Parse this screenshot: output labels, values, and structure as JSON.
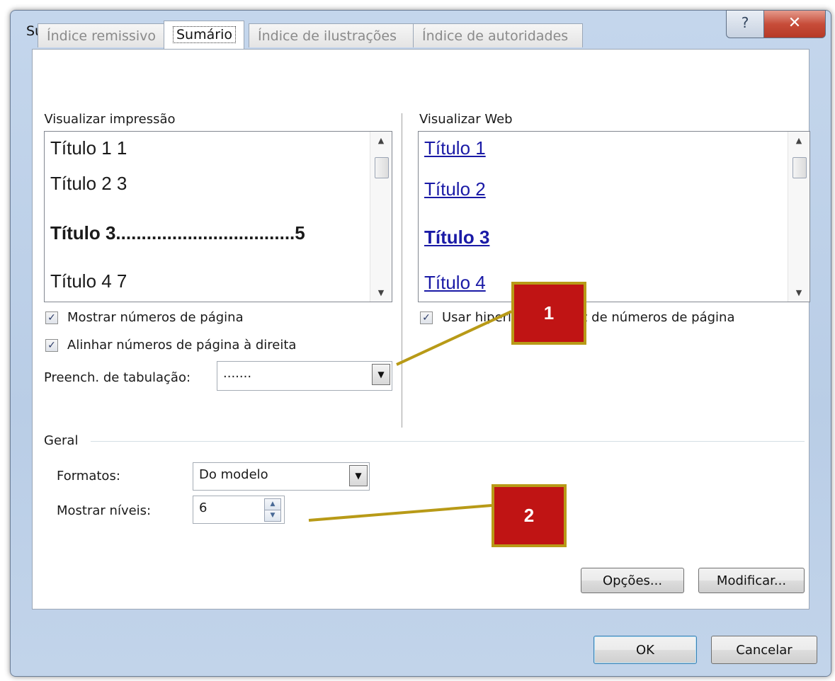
{
  "window": {
    "title": "Sumário",
    "help_glyph": "?",
    "close_glyph": "✕"
  },
  "tabs": [
    {
      "label": "Índice remissivo",
      "active": false
    },
    {
      "label": "Sumário",
      "active": true
    },
    {
      "label": "Índice de ilustrações",
      "active": false
    },
    {
      "label": "Índice de autoridades",
      "active": false
    }
  ],
  "print_preview": {
    "label": "Visualizar impressão",
    "lines": [
      "Título 1 1",
      "Título 2 3",
      "Título 3...................................5",
      "Título 4 7"
    ]
  },
  "web_preview": {
    "label": "Visualizar Web",
    "lines": [
      "Título 1",
      "Título 2",
      "Título 3",
      "Título 4"
    ]
  },
  "options": {
    "show_page_numbers": {
      "label": "Mostrar números de página",
      "checked": true
    },
    "right_align": {
      "label": "Alinhar números de página à direita",
      "checked": true
    },
    "use_hyperlinks": {
      "label": "Usar hiperlinks em vez de números de página",
      "checked": true
    },
    "tab_leader": {
      "label": "Preench. de tabulação:",
      "value": "......."
    }
  },
  "general": {
    "heading": "Geral",
    "formats_label": "Formatos:",
    "formats_value": "Do modelo",
    "levels_label": "Mostrar níveis:",
    "levels_value": "6"
  },
  "buttons": {
    "options": "Opções...",
    "modify": "Modificar...",
    "ok": "OK",
    "cancel": "Cancelar"
  },
  "callouts": [
    "1",
    "2"
  ],
  "colors": {
    "callout_fill": "#c01414",
    "callout_border": "#b89a17",
    "hyperlink": "#1a1aa6",
    "close_button": "#c74d3a"
  }
}
